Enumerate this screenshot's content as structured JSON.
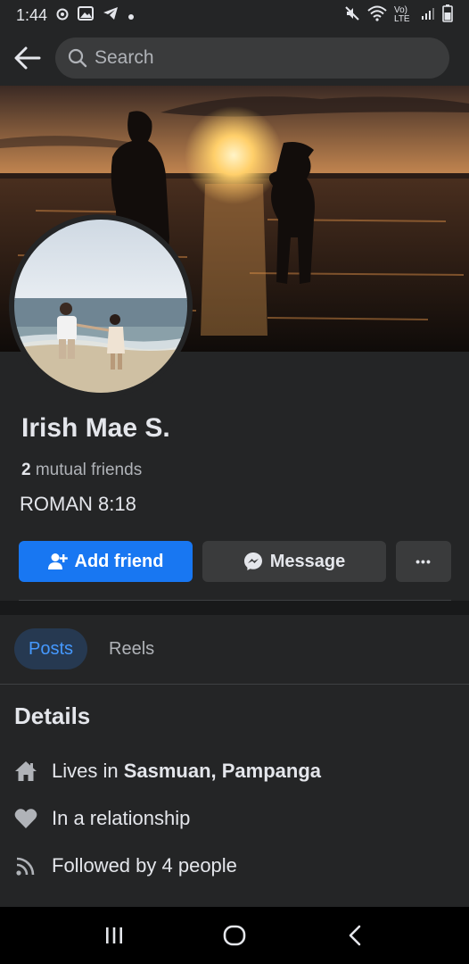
{
  "status_bar": {
    "time": "1:44",
    "network_label": "Vo) LTE"
  },
  "search": {
    "placeholder": "Search"
  },
  "profile": {
    "name": "Irish Mae  S.",
    "mutual_count": "2",
    "mutual_label": "mutual friends",
    "bio": "ROMAN 8:18"
  },
  "actions": {
    "add_friend": "Add friend",
    "message": "Message",
    "more": "•••"
  },
  "tabs": [
    {
      "label": "Posts",
      "active": true
    },
    {
      "label": "Reels",
      "active": false
    }
  ],
  "details": {
    "title": "Details",
    "lives_prefix": "Lives in",
    "lives_place": "Sasmuan, Pampanga",
    "relationship": "In a relationship",
    "followed": "Followed by 4 people"
  },
  "colors": {
    "accent": "#1877f2",
    "background": "#242526",
    "tab_active_bg": "#263951",
    "tab_active_text": "#4599ff"
  }
}
